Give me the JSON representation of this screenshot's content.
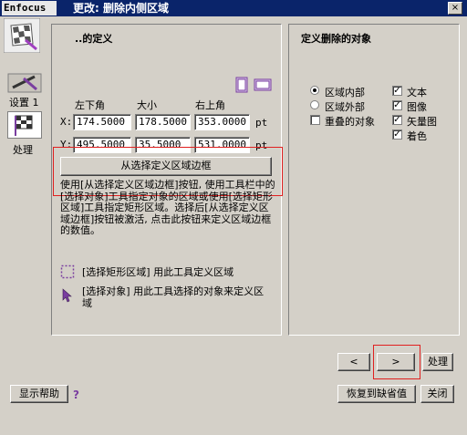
{
  "window": {
    "app_label": "Enfocus",
    "title": "更改: 删除内侧区域",
    "close_glyph": "×"
  },
  "sidebar": {
    "items": [
      {
        "label": "设置 1"
      },
      {
        "label": "处理"
      }
    ]
  },
  "left_panel": {
    "heading": "..的定义",
    "columns": {
      "lower_left": "左下角",
      "size": "大小",
      "upper_right": "右上角"
    },
    "rows": [
      {
        "axis": "X:",
        "lower_left": "174.5000",
        "size": "178.5000",
        "upper_right": "353.0000",
        "unit": "pt"
      },
      {
        "axis": "Y:",
        "lower_left": "495.5000",
        "size": "35.5000",
        "upper_right": "531.0000",
        "unit": "pt"
      }
    ],
    "define_button": "从选择定义区域边框",
    "help_text": "使用[从选择定义区域边框]按钮, 使用工具栏中的[选择对象]工具指定对象的区域或使用[选择矩形区域]工具指定矩形区域。选择后[从选择定义区域边框]按钮被激活, 点击此按钮来定义区域边框的数值。",
    "tool_hints": [
      {
        "text": "[选择矩形区域] 用此工具定义区域"
      },
      {
        "text": "[选择对象] 用此工具选择的对象来定义区域"
      }
    ]
  },
  "right_panel": {
    "heading": "定义删除的对象",
    "radios": [
      {
        "label": "区域内部",
        "checked": true
      },
      {
        "label": "区域外部",
        "checked": false
      }
    ],
    "overlap_checkbox": {
      "label": "重叠的对象",
      "checked": false
    },
    "type_checkboxes": [
      {
        "label": "文本",
        "checked": true
      },
      {
        "label": "图像",
        "checked": true
      },
      {
        "label": "矢量图",
        "checked": true
      },
      {
        "label": "着色",
        "checked": true
      }
    ]
  },
  "footer": {
    "prev_glyph": "<",
    "next_glyph": ">",
    "process": "处理",
    "show_help": "显示帮助",
    "help_glyph": "?",
    "restore_defaults": "恢复到缺省值",
    "close": "关闭"
  },
  "colors": {
    "title_bar": "#0a246a",
    "dialog_bg": "#d4d0c8",
    "highlight_box": "#e02020",
    "purple_icon": "#7a3ea0"
  },
  "icons": [
    "checkered-flag-icon",
    "wrench-icon",
    "page-portrait-icon",
    "page-landscape-icon",
    "select-rect-icon",
    "select-object-arrow-icon",
    "help-question-icon"
  ]
}
